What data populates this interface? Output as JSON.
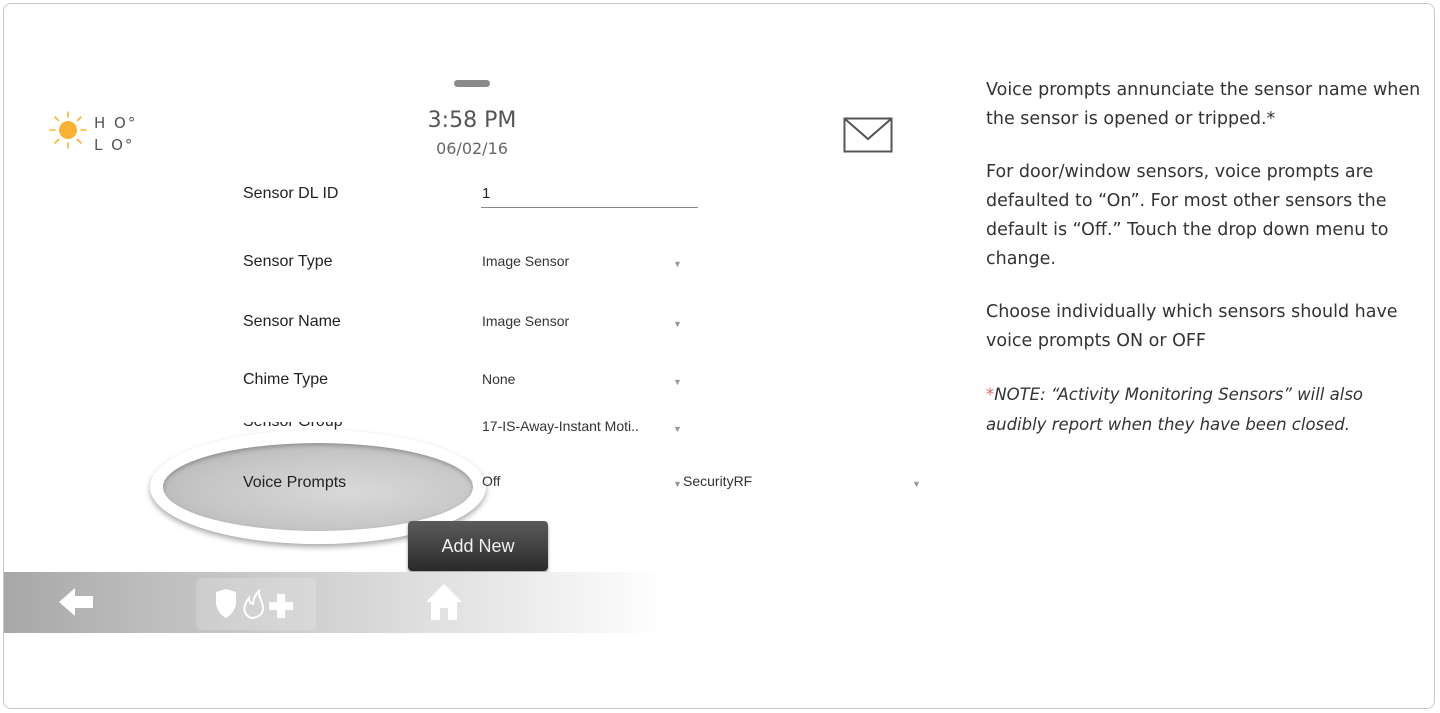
{
  "weather": {
    "high": "H O°",
    "low": "L O°",
    "icon": "sun-icon"
  },
  "clock": {
    "time": "3:58 PM",
    "date": "06/02/16"
  },
  "form": {
    "sensor_dl_id": {
      "label": "Sensor DL ID",
      "value": "1"
    },
    "sensor_type": {
      "label": "Sensor Type",
      "value": "Image Sensor"
    },
    "sensor_name": {
      "label": "Sensor Name",
      "value": "Image Sensor"
    },
    "chime_type": {
      "label": "Chime Type",
      "value": "None"
    },
    "sensor_group": {
      "label": "Sensor Group",
      "value": "17-IS-Away-Instant Moti.."
    },
    "voice_prompts": {
      "label": "Voice Prompts",
      "value": "Off",
      "source": "SecurityRF"
    },
    "add_new_label": "Add New"
  },
  "nav": {
    "icons": [
      "back-arrow-icon",
      "shield-icon",
      "flame-icon",
      "plus-icon",
      "home-icon"
    ]
  },
  "help": {
    "p1": "Voice prompts annunciate the sensor name when the sensor is opened or tripped.",
    "p1_mark": "*",
    "p2": "For door/window sensors, voice prompts are defaulted to “On”. For most other sensors the default is “Off.” Touch the drop down menu to change.",
    "p3": "Choose individually which sensors should have voice prompts ON or OFF",
    "note_mark": "*",
    "note": "NOTE: “Activity Monitoring Sensors” will also audibly report when they have been closed."
  },
  "colors": {
    "accent_red": "#e26a5a",
    "sun": "#f9b233"
  }
}
